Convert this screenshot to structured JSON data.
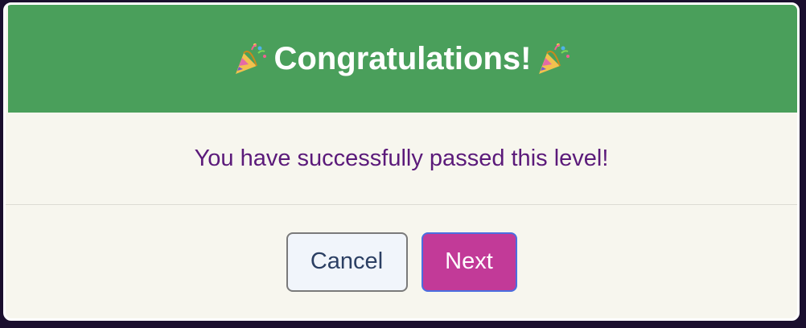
{
  "dialog": {
    "title": "Congratulations!",
    "message": "You have successfully passed this level!",
    "cancel_label": "Cancel",
    "next_label": "Next"
  },
  "icons": {
    "title_left": "party-popper-icon",
    "title_right": "party-popper-icon"
  },
  "colors": {
    "header_bg": "#4a9f5b",
    "body_bg": "#f7f6ee",
    "message_text": "#5b1a7a",
    "next_button_bg": "#c23a98",
    "next_button_border": "#4a6ee0",
    "cancel_button_bg": "#f1f5fb"
  }
}
